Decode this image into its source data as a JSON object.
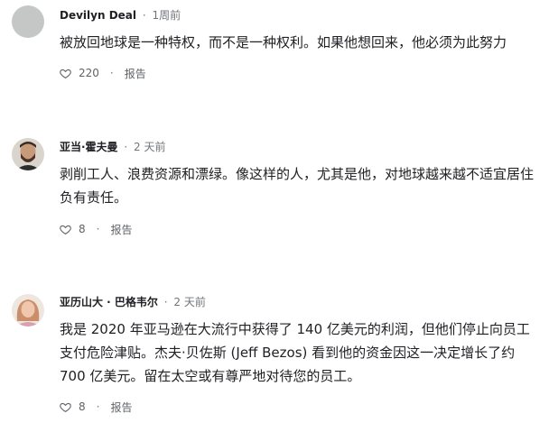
{
  "comments": [
    {
      "author": "Devilyn Deal",
      "time": "1周前",
      "text": "被放回地球是一种特权，而不是一种权利。如果他想回来，他必须为此努力",
      "likes": "220",
      "report": "报告",
      "avatar": "default-gray"
    },
    {
      "author": "亚当·霍夫曼",
      "time": "2 天前",
      "text": "剥削工人、浪费资源和漂绿。像这样的人，尤其是他，对地球越来越不适宜居住负有责任。",
      "likes": "8",
      "report": "报告",
      "avatar": "man-with-beard"
    },
    {
      "author": "亚历山大 · 巴格韦尔",
      "time": "2 天前",
      "text": "我是 2020 年亚马逊在大流行中获得了 140 亿美元的利润，但他们停止向员工支付危险津贴。杰夫·贝佐斯 (Jeff Bezos) 看到他的资金因这一决定增长了约 700 亿美元。留在太空或有尊严地对待您的员工。",
      "likes": "8",
      "report": "报告",
      "avatar": "woman-portrait"
    }
  ],
  "colors": {
    "author": "#202124",
    "meta": "#70757a",
    "action": "#5f6368"
  }
}
